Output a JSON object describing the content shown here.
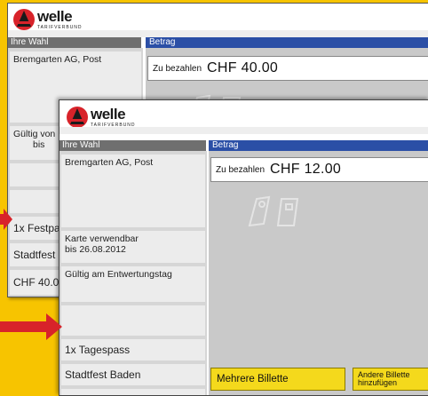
{
  "brand": {
    "name": "welle",
    "tagline": "TARIFVERBUND",
    "accent": "#d8232a"
  },
  "back_screen": {
    "header_left": "Ihre Wahl",
    "header_right": "Betrag",
    "route": "Bremgarten AG, Post",
    "validity_partial": "Gültig von",
    "validity_partial2": "bis",
    "ticket_partial": "1x Festpa",
    "event_partial": "Stadtfest",
    "price_partial": "CHF  40.0",
    "pay_label": "Zu bezahlen",
    "pay_amount": "CHF  40.00"
  },
  "front_screen": {
    "header_left": "Ihre Wahl",
    "header_right": "Betrag",
    "route": "Bremgarten AG, Post",
    "card_usable_line1": "Karte verwendbar",
    "card_usable_line2": "bis 26.08.2012",
    "validity": "Gültig am Entwertungstag",
    "ticket": "1x Tagespass",
    "event": "Stadtfest Baden",
    "price": "CHF  12.00",
    "pay_label": "Zu bezahlen",
    "pay_amount": "CHF  12.00",
    "button_multiple": "Mehrere Billette",
    "button_add_line1": "Andere Billette",
    "button_add_line2": "hinzufügen"
  },
  "colors": {
    "background": "#f7c400",
    "header_blue": "#2b4fa6",
    "header_grey": "#6f6f6f",
    "button_yellow": "#f4d91c",
    "arrow_red": "#d8232a"
  },
  "icons": [
    "card-insert-icon",
    "arrow-right-icon"
  ]
}
